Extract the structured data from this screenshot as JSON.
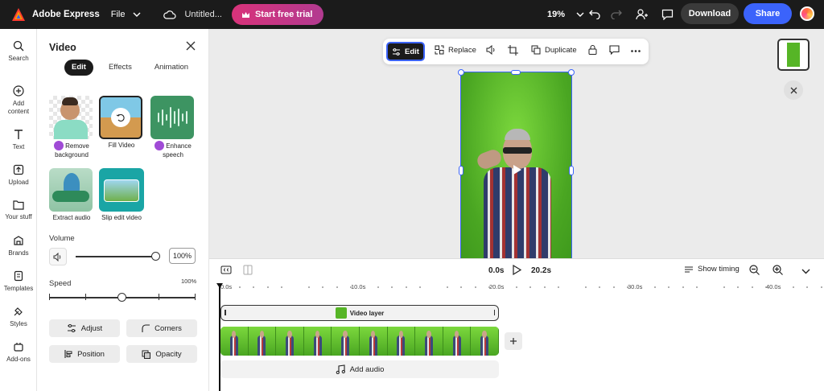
{
  "topbar": {
    "brand": "Adobe Express",
    "file_menu": "File",
    "doc_title": "Untitled...",
    "trial_button": "Start free trial",
    "zoom": "19%",
    "download": "Download",
    "share": "Share"
  },
  "rail": {
    "items": [
      {
        "label": "Search",
        "icon": "search-icon"
      },
      {
        "label": "Add content",
        "icon": "plus-circle-icon"
      },
      {
        "label": "Text",
        "icon": "text-icon"
      },
      {
        "label": "Upload",
        "icon": "upload-icon"
      },
      {
        "label": "Your stuff",
        "icon": "folder-icon"
      },
      {
        "label": "Brands",
        "icon": "brand-icon"
      },
      {
        "label": "Templates",
        "icon": "templates-icon"
      },
      {
        "label": "Styles",
        "icon": "styles-icon"
      },
      {
        "label": "Add-ons",
        "icon": "addons-icon"
      }
    ]
  },
  "panel": {
    "title": "Video",
    "tabs": [
      "Edit",
      "Effects",
      "Animation"
    ],
    "active_tab": "Edit",
    "tools": [
      {
        "label": "Remove background",
        "premium": true
      },
      {
        "label": "Fill Video",
        "premium": false
      },
      {
        "label": "Enhance speech",
        "premium": true
      },
      {
        "label": "Extract audio",
        "premium": false
      },
      {
        "label": "Slip edit video",
        "premium": false
      }
    ],
    "volume_label": "Volume",
    "volume_value": "100%",
    "volume_level": 1.0,
    "speed_label": "Speed",
    "speed_value": "100%",
    "speed_level": 0.5,
    "buttons": {
      "adjust": "Adjust",
      "corners": "Corners",
      "position": "Position",
      "opacity": "Opacity"
    }
  },
  "context_toolbar": {
    "edit": "Edit",
    "replace": "Replace",
    "duplicate": "Duplicate"
  },
  "timeline": {
    "current_time": "0.0s",
    "total_time": "20.2s",
    "show_timing": "Show timing",
    "ruler": [
      "0.0s",
      "10.0s",
      "20.0s",
      "30.0s",
      "40.0s"
    ],
    "layer_label": "Video layer",
    "add_audio": "Add audio"
  },
  "colors": {
    "accent": "#3b63fb",
    "trial_gradient_start": "#d8337a",
    "trial_gradient_end": "#b23a90",
    "green_screen": "#4aa622",
    "premium": "#a04bd6"
  }
}
